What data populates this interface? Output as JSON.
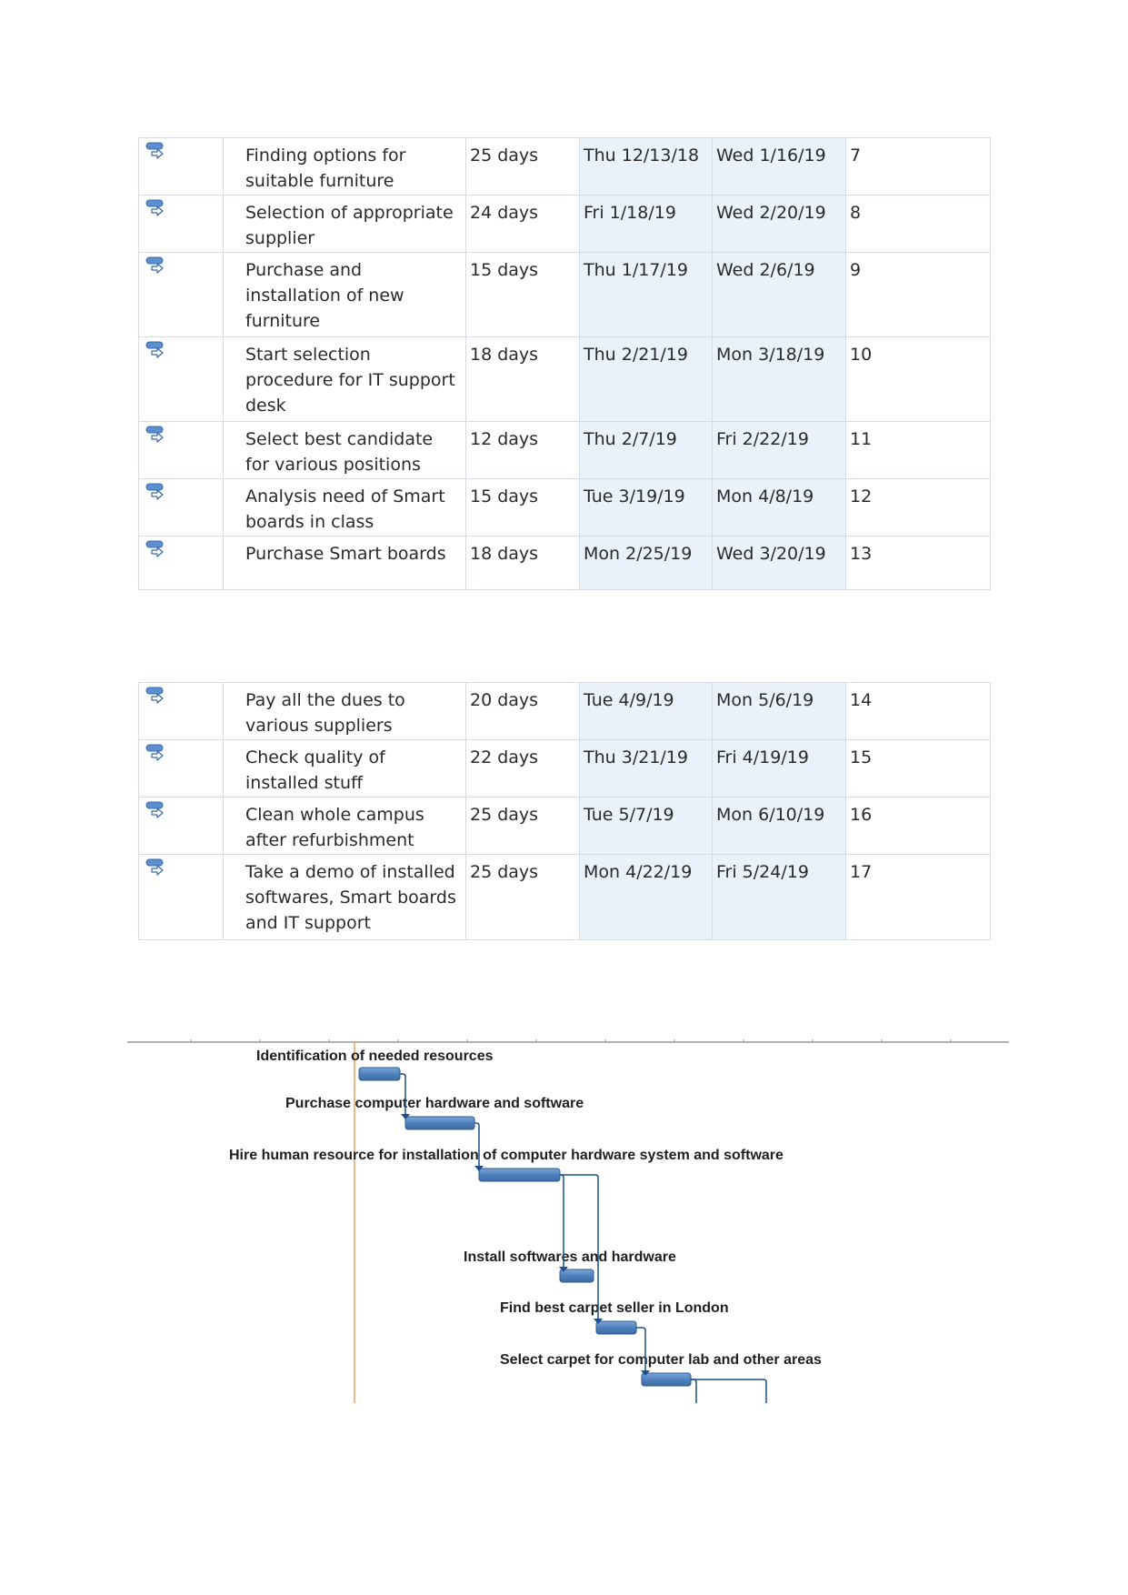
{
  "table1": {
    "rows": [
      {
        "name": "Finding options for suitable furniture",
        "duration": "25 days",
        "start": "Thu 12/13/18",
        "finish": "Wed 1/16/19",
        "predecessors": "7",
        "lines": [
          "Finding options for",
          "suitable furniture"
        ]
      },
      {
        "name": "Selection of appropriate supplier",
        "duration": "24 days",
        "start": "Fri 1/18/19",
        "finish": "Wed 2/20/19",
        "predecessors": "8",
        "lines": [
          "Selection of appropriate",
          "supplier"
        ]
      },
      {
        "name": "Purchase and installation of new furniture",
        "duration": "15 days",
        "start": "Thu 1/17/19",
        "finish": "Wed 2/6/19",
        "predecessors": "9",
        "lines": [
          "Purchase and",
          "installation of new",
          "furniture"
        ]
      },
      {
        "name": "Start selection procedure for IT support desk",
        "duration": "18 days",
        "start": "Thu 2/21/19",
        "finish": "Mon 3/18/19",
        "predecessors": "10",
        "lines": [
          "Start selection",
          "procedure for IT support",
          "desk"
        ]
      },
      {
        "name": "Select best candidate for various positions",
        "duration": "12 days",
        "start": "Thu 2/7/19",
        "finish": "Fri 2/22/19",
        "predecessors": "11",
        "lines": [
          "Select best candidate",
          "for various positions"
        ]
      },
      {
        "name": "Analysis need of Smart boards in class",
        "duration": "15 days",
        "start": "Tue 3/19/19",
        "finish": "Mon 4/8/19",
        "predecessors": "12",
        "lines": [
          "Analysis need of Smart",
          "boards in class"
        ]
      },
      {
        "name": "Purchase Smart boards",
        "duration": "18 days",
        "start": "Mon 2/25/19",
        "finish": "Wed 3/20/19",
        "predecessors": "13",
        "lines": [
          "Purchase Smart boards"
        ]
      }
    ]
  },
  "table2": {
    "rows": [
      {
        "name": "Pay all the dues to various suppliers",
        "duration": "20 days",
        "start": "Tue 4/9/19",
        "finish": "Mon 5/6/19",
        "predecessors": "14",
        "lines": [
          "Pay all the dues to",
          "various suppliers"
        ]
      },
      {
        "name": "Check quality of installed stuff",
        "duration": "22 days",
        "start": "Thu 3/21/19",
        "finish": "Fri 4/19/19",
        "predecessors": "15",
        "lines": [
          "Check quality of",
          "installed stuff"
        ]
      },
      {
        "name": "Clean whole campus after refurbishment",
        "duration": "25 days",
        "start": "Tue 5/7/19",
        "finish": "Mon 6/10/19",
        "predecessors": "16",
        "lines": [
          "Clean whole campus",
          "after refurbishment"
        ]
      },
      {
        "name": "Take a demo of installed softwares, Smart boards and IT support",
        "duration": "25 days",
        "start": "Mon 4/22/19",
        "finish": "Fri 5/24/19",
        "predecessors": "17",
        "lines": [
          "Take a demo of installed",
          "softwares, Smart boards",
          "and IT support"
        ]
      }
    ]
  },
  "gantt": {
    "tasks": [
      {
        "label": "Identification of needed resources"
      },
      {
        "label": "Purchase computer hardware and software"
      },
      {
        "label": "Hire human resource for installation of computer hardware system and software"
      },
      {
        "label": "Install softwares and hardware"
      },
      {
        "label": "Find best carpet seller in London"
      },
      {
        "label": "Select carpet for computer lab and other areas"
      }
    ],
    "colors": {
      "bar": "#4f81bd",
      "bar_dark": "#2c5a8f",
      "link": "#1f4e8c",
      "today_line": "#f0a060",
      "timescale": "#999999"
    }
  }
}
